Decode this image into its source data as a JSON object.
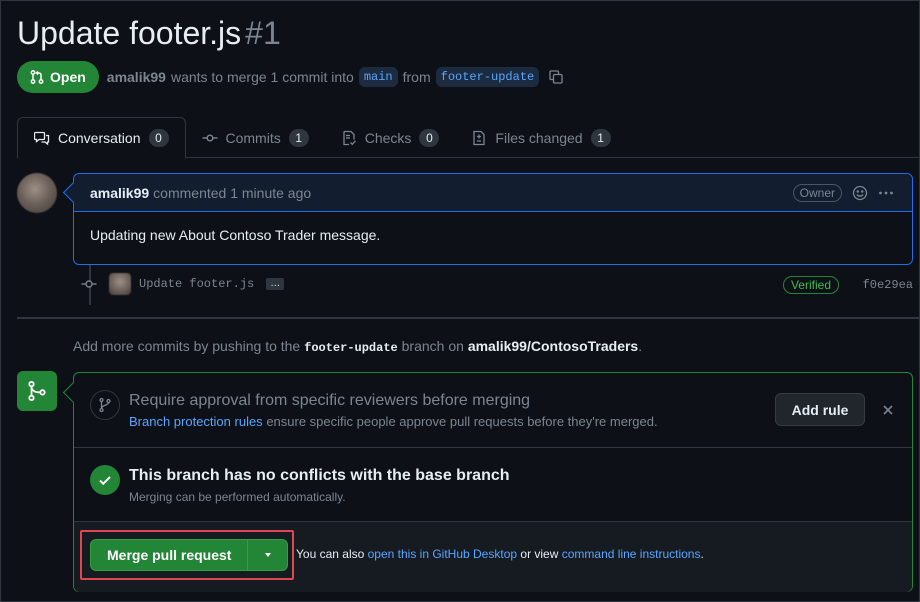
{
  "pr": {
    "title": "Update footer.js",
    "number": "#1",
    "state": "Open",
    "author": "amalik99",
    "summary_text": "wants to merge 1 commit into",
    "base_branch": "main",
    "from_text": "from",
    "head_branch": "footer-update"
  },
  "tabs": [
    {
      "label": "Conversation",
      "count": "0",
      "icon": "comment-discussion-icon"
    },
    {
      "label": "Commits",
      "count": "1",
      "icon": "git-commit-icon"
    },
    {
      "label": "Checks",
      "count": "0",
      "icon": "checklist-icon"
    },
    {
      "label": "Files changed",
      "count": "1",
      "icon": "file-diff-icon"
    }
  ],
  "comment": {
    "author": "amalik99",
    "meta": "commented 1 minute ago",
    "role_badge": "Owner",
    "body": "Updating new About Contoso Trader message."
  },
  "commit": {
    "message": "Update footer.js",
    "ellipsis": "…",
    "verified": "Verified",
    "sha": "f0e29ea"
  },
  "push_hint": {
    "prefix": "Add more commits by pushing to the",
    "branch": "footer-update",
    "middle": "branch on",
    "repo": "amalik99/ContosoTraders",
    "suffix": "."
  },
  "merge_box": {
    "review_title": "Require approval from specific reviewers before merging",
    "review_link": "Branch protection rules",
    "review_desc": "ensure specific people approve pull requests before they're merged.",
    "add_rule_label": "Add rule",
    "conflict_title": "This branch has no conflicts with the base branch",
    "conflict_desc": "Merging can be performed automatically.",
    "merge_button_label": "Merge pull request",
    "also_prefix": "You can also",
    "desktop_link": "open this in GitHub Desktop",
    "or_view": "or view",
    "cli_link": "command line instructions",
    "also_suffix": "."
  },
  "colors": {
    "background": "#0d1117",
    "accent_green": "#238636",
    "link_blue": "#58a6ff",
    "highlight_red": "#e0474e"
  }
}
